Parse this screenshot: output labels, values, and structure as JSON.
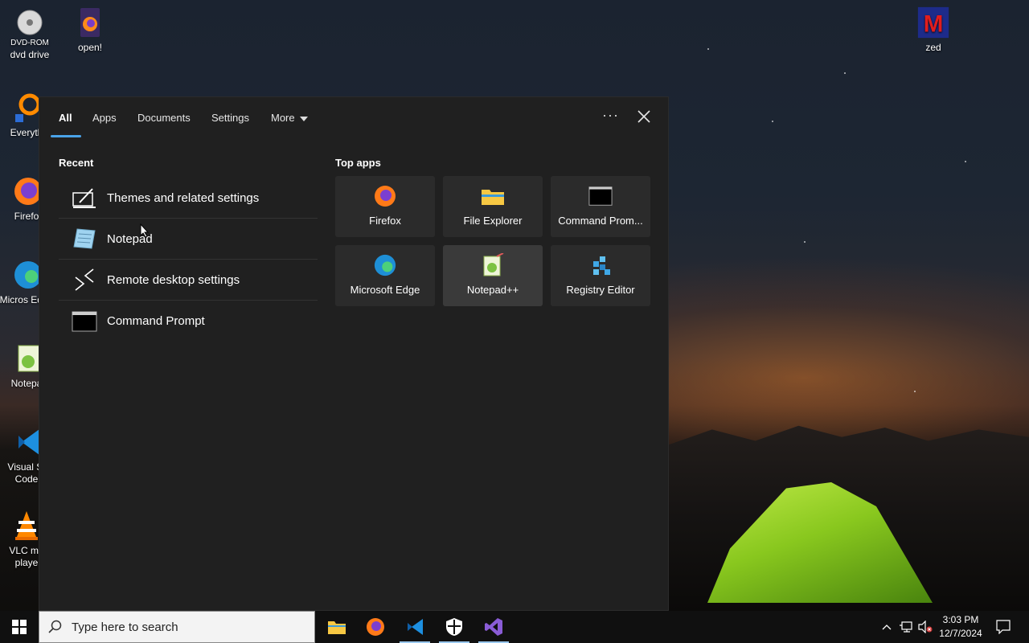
{
  "desktop": {
    "icons": [
      {
        "label": "dvd drive",
        "sublabel": "DVD-ROM"
      },
      {
        "label": "open!"
      },
      {
        "label": "zed"
      },
      {
        "label": "Everyth"
      },
      {
        "label": "Firefo"
      },
      {
        "label": "Micros Edge"
      },
      {
        "label": "Notepa"
      },
      {
        "label": "Visual St Code"
      },
      {
        "label": "VLC me playe"
      }
    ]
  },
  "panel": {
    "tabs": [
      {
        "label": "All",
        "active": true
      },
      {
        "label": "Apps"
      },
      {
        "label": "Documents"
      },
      {
        "label": "Settings"
      },
      {
        "label": "More"
      }
    ],
    "ellipsis": "···",
    "recent": {
      "title": "Recent",
      "items": [
        {
          "label": "Themes and related settings",
          "icon": "themes-settings-icon"
        },
        {
          "label": "Notepad",
          "icon": "notepad-icon"
        },
        {
          "label": "Remote desktop settings",
          "icon": "remote-desktop-icon"
        },
        {
          "label": "Command Prompt",
          "icon": "command-prompt-icon"
        }
      ]
    },
    "top_apps": {
      "title": "Top apps",
      "items": [
        {
          "label": "Firefox",
          "icon": "firefox-icon"
        },
        {
          "label": "File Explorer",
          "icon": "file-explorer-icon"
        },
        {
          "label": "Command Prom...",
          "icon": "command-prompt-icon"
        },
        {
          "label": "Microsoft Edge",
          "icon": "edge-icon"
        },
        {
          "label": "Notepad++",
          "icon": "notepadpp-icon"
        },
        {
          "label": "Registry Editor",
          "icon": "registry-editor-icon"
        }
      ]
    }
  },
  "taskbar": {
    "search_placeholder": "Type here to search",
    "apps": [
      "file-explorer",
      "firefox",
      "vscode",
      "security",
      "visual-studio"
    ],
    "clock": {
      "time": "3:03 PM",
      "date": "12/7/2024"
    }
  },
  "colors": {
    "panel_bg": "#202020",
    "tile_bg": "#2b2b2b",
    "accent": "#4aa3e8",
    "taskbar_bg": "#101010"
  }
}
